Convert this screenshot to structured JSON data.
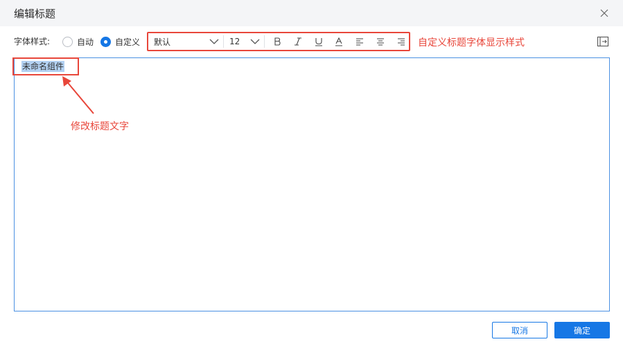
{
  "dialog": {
    "title": "编辑标题"
  },
  "font_style": {
    "label": "字体样式:",
    "options": [
      {
        "label": "自动",
        "checked": false
      },
      {
        "label": "自定义",
        "checked": true
      }
    ]
  },
  "toolbar": {
    "font_family_value": "默认",
    "font_size_value": "12",
    "buttons": [
      "bold-icon",
      "italic-icon",
      "underline-icon",
      "font-color-icon",
      "align-left-icon",
      "align-center-icon",
      "align-right-icon"
    ]
  },
  "annotations": {
    "toolbar_note": "自定义标题字体显示样式",
    "text_note": "修改标题文字"
  },
  "editor": {
    "text": "未命名组件"
  },
  "footer": {
    "cancel_label": "取消",
    "ok_label": "确定"
  },
  "colors": {
    "accent": "#1677e5",
    "annotation": "#e8463a",
    "header_bg": "#f4f5f7",
    "selection": "#b3d1f2"
  }
}
